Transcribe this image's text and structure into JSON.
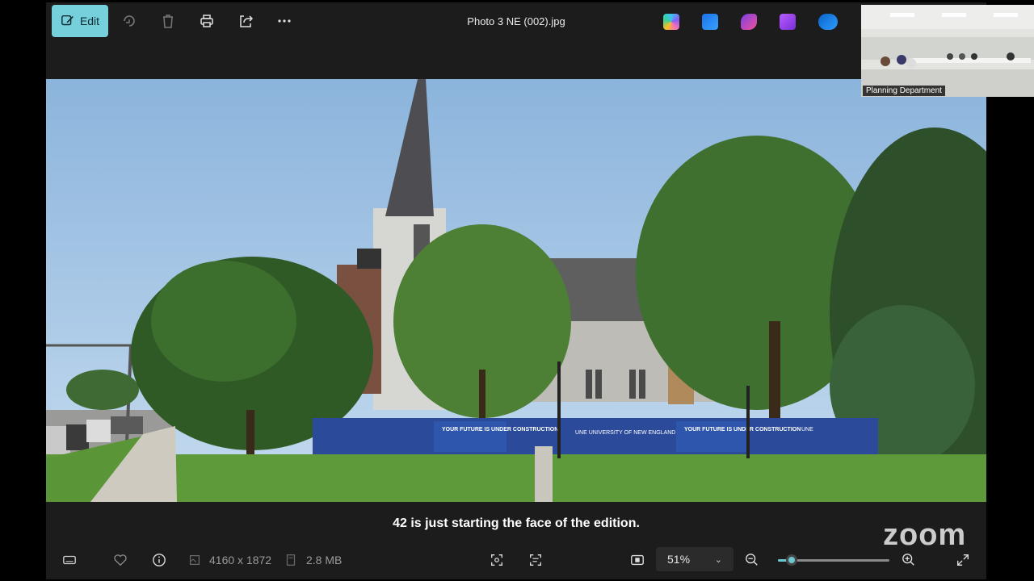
{
  "toolbar": {
    "edit_label": "Edit",
    "icons": [
      "edit-icon",
      "rotate-icon",
      "delete-icon",
      "print-icon",
      "share-icon",
      "more-icon"
    ]
  },
  "window": {
    "title": "Photo 3 NE (002).jpg"
  },
  "app_icons": [
    "copilot-icon",
    "designer-icon",
    "clipchamp-icon",
    "clipchamp-video-icon",
    "onedrive-icon"
  ],
  "photo": {
    "banner_texts": [
      "YOUR FUTURE IS UNDER CONSTRUCTION",
      "UNE UNIVERSITY OF NEW ENGLAND",
      "YOUR FUTURE IS UNDER CONSTRUCTION",
      "UNE"
    ]
  },
  "caption": {
    "text": "42 is just starting the face of the edition."
  },
  "bottom": {
    "dimensions": "4160 x 1872",
    "file_size": "2.8 MB",
    "zoom_value": "51%",
    "zoom_level": 0.12
  },
  "participant": {
    "name": "Planning Department"
  },
  "overlay": {
    "logo": "zoom"
  },
  "colors": {
    "accent": "#76d0dc",
    "background": "#1c1c1c"
  }
}
